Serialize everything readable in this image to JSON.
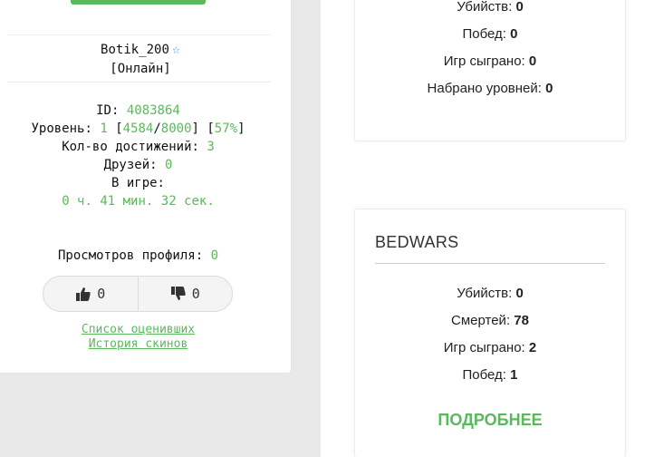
{
  "profile": {
    "username": "Botik_200",
    "status": "[Онлайн]",
    "id_label": "ID: ",
    "id_value": "4083864",
    "level_label": "Уровень: ",
    "level": "1",
    "xp_current": "4584",
    "xp_max": "8000",
    "xp_percent": "57%",
    "achievements_label": "Кол-во достижений: ",
    "achievements": "3",
    "friends_label": "Друзей: ",
    "friends": "0",
    "ingame_label": "В игре:",
    "ingame_time": "0 ч. 41 мин. 32 сек.",
    "views_label": "Просмотров профиля: ",
    "views": "0",
    "likes": "0",
    "dislikes": "0",
    "raters_link": "Список оценивших",
    "skins_link": "История скинов"
  },
  "top_card": {
    "stats": [
      {
        "label": "Убийств:",
        "value": "0"
      },
      {
        "label": "Побед:",
        "value": "0"
      },
      {
        "label": "Игр сыграно:",
        "value": "0"
      },
      {
        "label": "Набрано уровней:",
        "value": "0"
      }
    ]
  },
  "bedwars_card": {
    "title": "BEDWARS",
    "stats": [
      {
        "label": "Убийств:",
        "value": "0"
      },
      {
        "label": "Смертей:",
        "value": "78"
      },
      {
        "label": "Игр сыграно:",
        "value": "2"
      },
      {
        "label": "Побед:",
        "value": "1"
      }
    ],
    "more": "ПОДРОБНЕЕ"
  },
  "colors": {
    "accent": "#5cb85c",
    "star": "#3aa0d8"
  }
}
